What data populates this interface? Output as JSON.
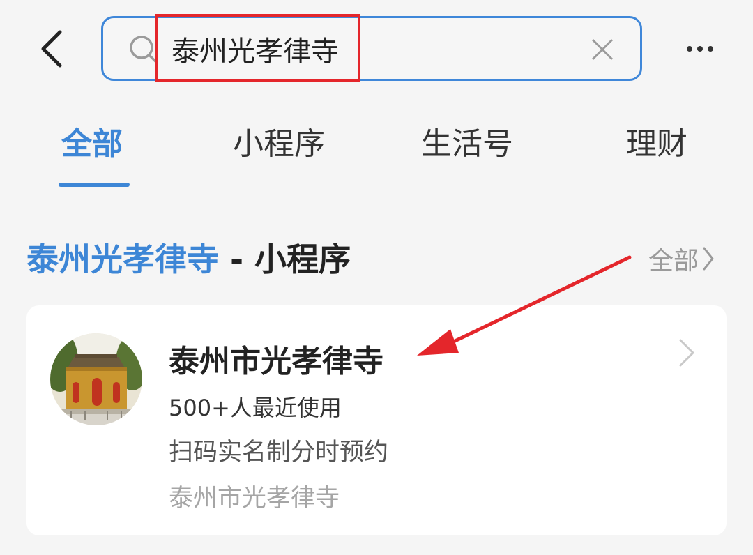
{
  "search": {
    "query": "泰州光孝律寺"
  },
  "tabs": [
    {
      "label": "全部",
      "active": true
    },
    {
      "label": "小程序",
      "active": false
    },
    {
      "label": "生活号",
      "active": false
    },
    {
      "label": "理财",
      "active": false
    }
  ],
  "section": {
    "keyword": "泰州光孝律寺",
    "separator": " - ",
    "category": "小程序",
    "more_label": "全部"
  },
  "result": {
    "title": "泰州市光孝律寺",
    "usage": "500+人最近使用",
    "description": "扫码实名制分时预约",
    "organization": "泰州市光孝律寺"
  },
  "icons": {
    "back": "chevron-left-icon",
    "search": "search-icon",
    "clear": "close-icon",
    "more": "more-dots-icon",
    "section_more": "chevron-right-icon",
    "card_more": "chevron-right-icon"
  },
  "colors": {
    "accent": "#3d86d6",
    "annotation": "#e4262b",
    "background": "#f5f5f5",
    "card": "#ffffff",
    "muted_text": "#a5a5a5"
  }
}
